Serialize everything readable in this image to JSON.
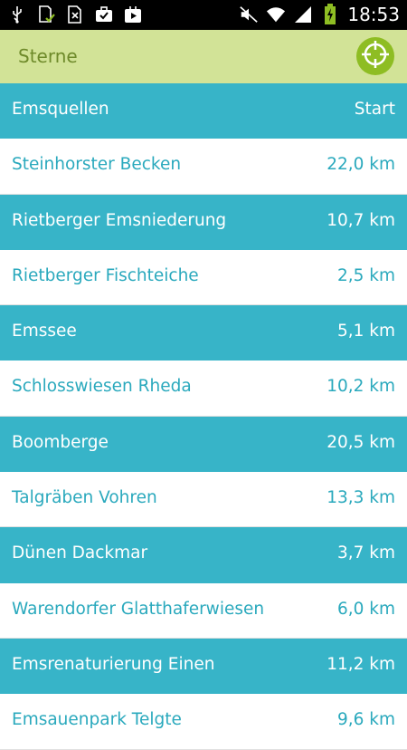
{
  "statusbar": {
    "time": "18:53",
    "icons": [
      "usb-icon",
      "sd-card-check-icon",
      "no-sim-icon",
      "briefcase-icon",
      "play-store-icon",
      "mute-icon",
      "wifi-icon",
      "signal-icon",
      "battery-charging-icon"
    ]
  },
  "appbar": {
    "title": "Sterne",
    "action_icon": "crosshair-locate-icon"
  },
  "header_row": {
    "name": "Emsquellen",
    "dist": "Start"
  },
  "list": [
    {
      "name": "Steinhorster Becken",
      "dist": "22,0 km"
    },
    {
      "name": "Rietberger Emsniederung",
      "dist": "10,7 km"
    },
    {
      "name": "Rietberger Fischteiche",
      "dist": "2,5 km"
    },
    {
      "name": "Emssee",
      "dist": "5,1 km"
    },
    {
      "name": "Schlosswiesen Rheda",
      "dist": "10,2 km"
    },
    {
      "name": "Boomberge",
      "dist": "20,5 km"
    },
    {
      "name": "Talgräben Vohren",
      "dist": "13,3 km"
    },
    {
      "name": "Dünen Dackmar",
      "dist": "3,7 km"
    },
    {
      "name": "Warendorfer Glatthaferwiesen",
      "dist": "6,0 km"
    },
    {
      "name": "Emsrenaturierung Einen",
      "dist": "11,2 km"
    },
    {
      "name": "Emsauenpark Telgte",
      "dist": "9,6 km"
    }
  ],
  "colors": {
    "statusbar": "#000000",
    "appbar": "#d2e397",
    "title": "#6e8a2a",
    "accent_button": "#8ebd23",
    "teal_row": "#37b4c8",
    "white_row_text": "#2aa9bd"
  }
}
